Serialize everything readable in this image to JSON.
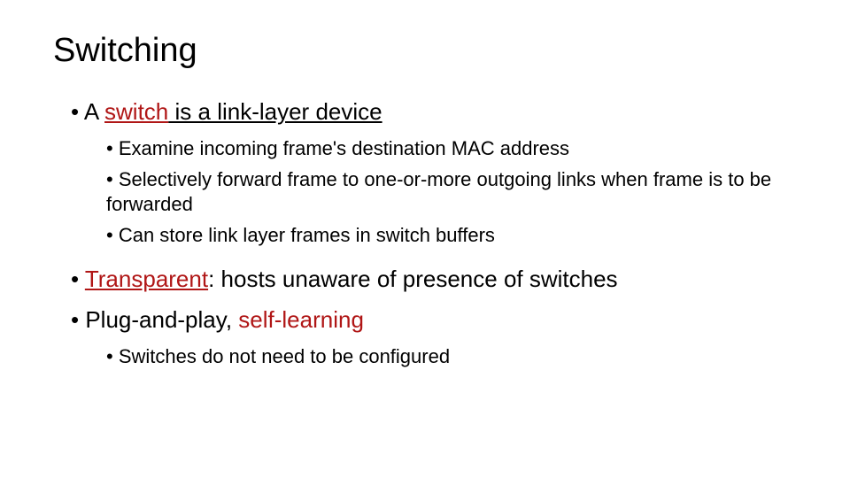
{
  "title": "Switching",
  "b1": {
    "prefix": "• A ",
    "keyword": "switch",
    "rest": " is a link-layer device",
    "sub1": "• Examine incoming frame's destination MAC address",
    "sub2": "• Selectively forward frame to one-or-more outgoing links when frame is to be forwarded",
    "sub3": "• Can store link layer frames in switch buffers"
  },
  "b2": {
    "prefix": "• ",
    "keyword": "Transparent",
    "rest": ": hosts unaware of presence of switches"
  },
  "b3": {
    "prefix": "• Plug-and-play, ",
    "keyword": "self-learning",
    "sub1": "• Switches do not need to be configured"
  }
}
